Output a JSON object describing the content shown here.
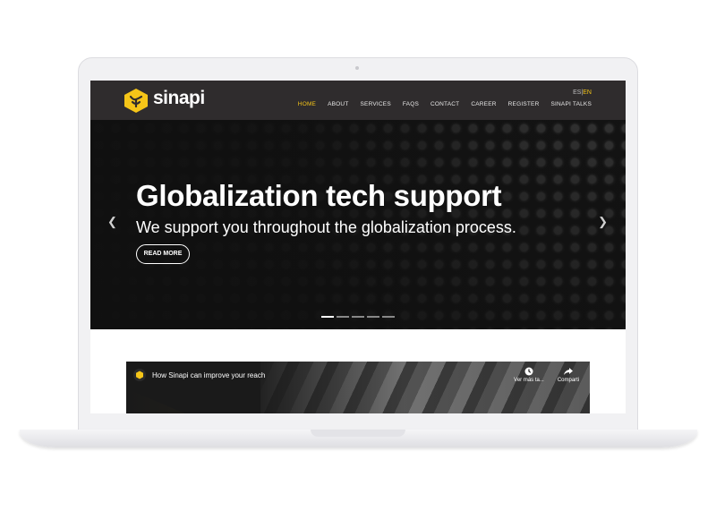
{
  "site": {
    "brand": "sinapi",
    "lang": {
      "es": "ES",
      "sep": "|",
      "en": "EN"
    },
    "nav": [
      "HOME",
      "ABOUT",
      "SERVICES",
      "FAQS",
      "CONTACT",
      "CAREER",
      "REGISTER",
      "SINAPI TALKS"
    ],
    "active_nav": "HOME",
    "accent_color": "#f5c518"
  },
  "hero": {
    "title": "Globalization tech support",
    "subtitle": "We support you throughout the globalization process.",
    "button": "READ MORE",
    "slides": 5,
    "active_slide": 1
  },
  "video": {
    "title": "How Sinapi can improve your reach",
    "actions": [
      {
        "icon": "clock-icon",
        "label": "Ver más ta..."
      },
      {
        "icon": "share-icon",
        "label": "Comparti"
      }
    ]
  }
}
